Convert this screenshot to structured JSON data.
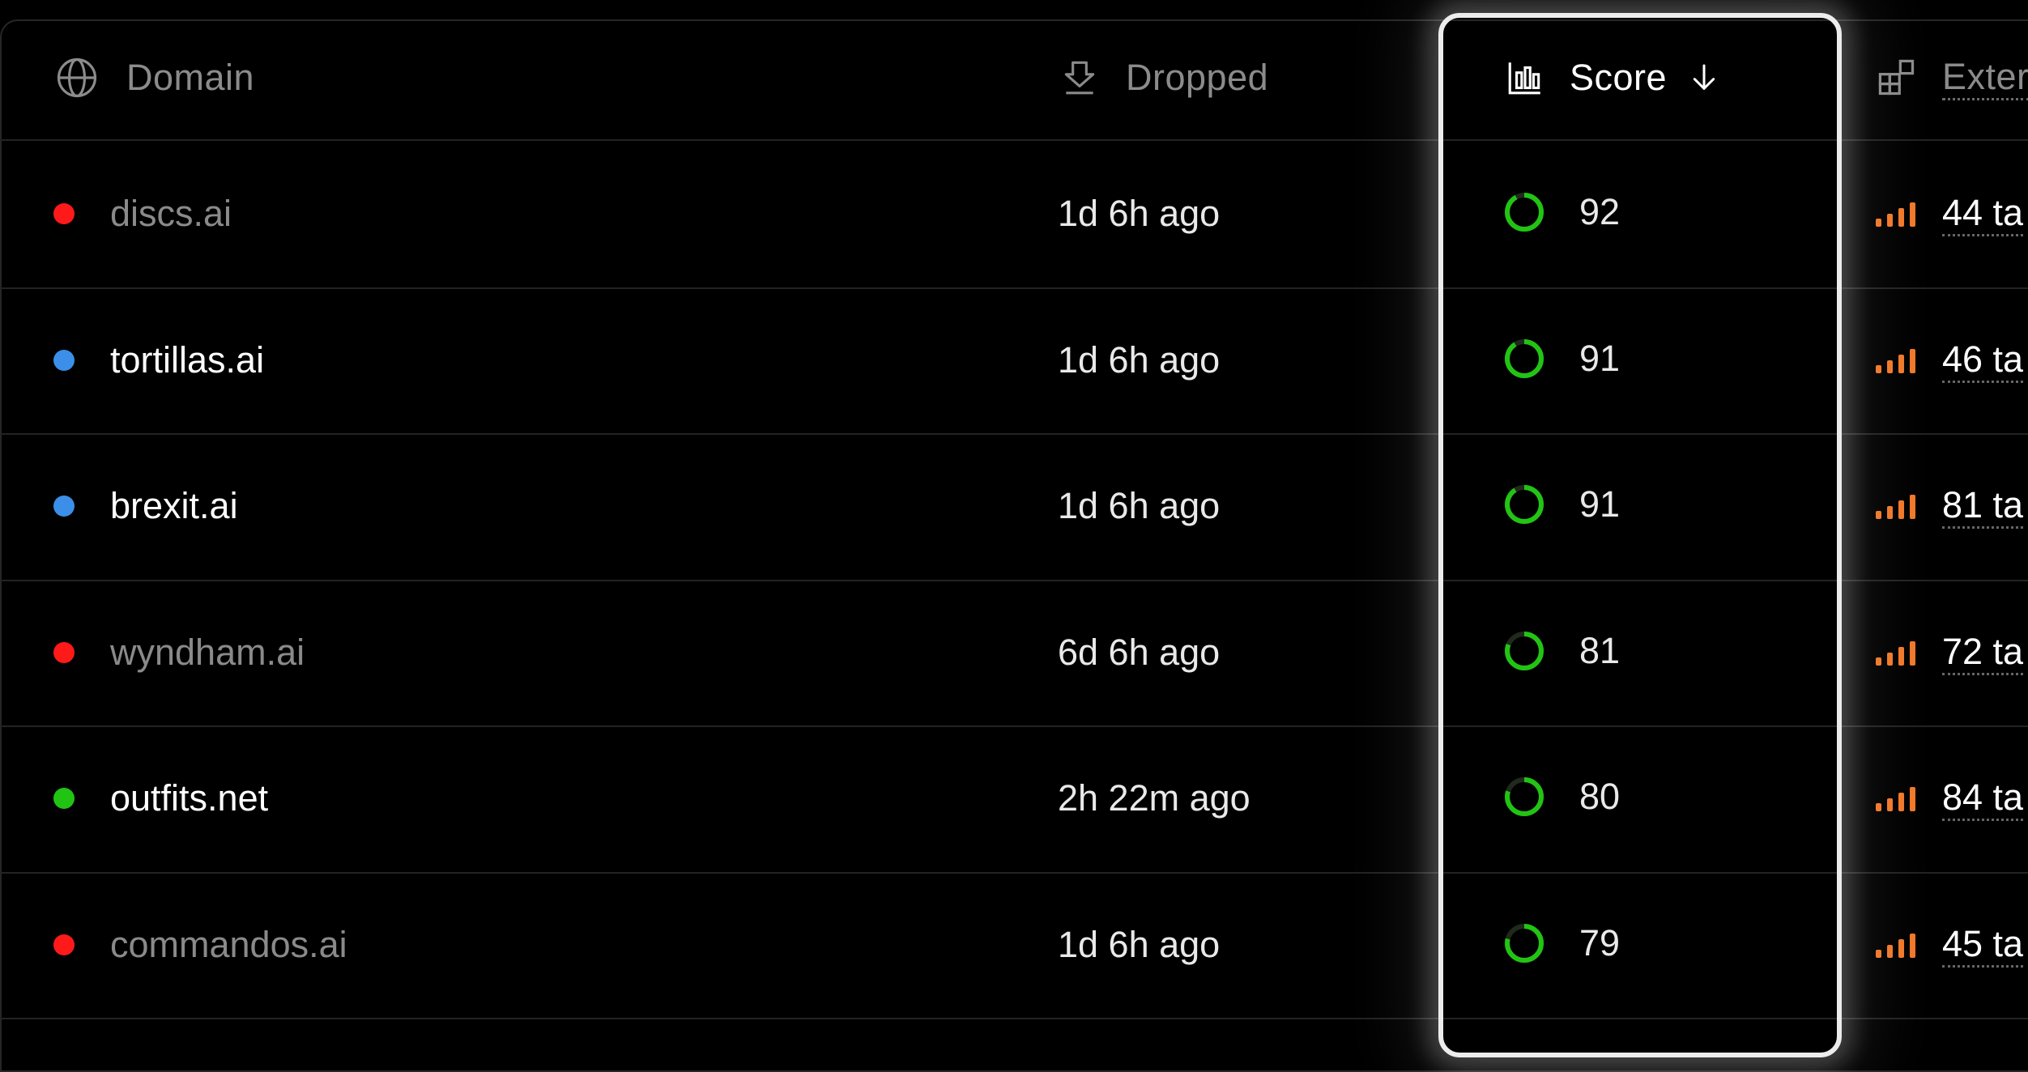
{
  "columns": {
    "domain": "Domain",
    "dropped": "Dropped",
    "score": "Score",
    "external": "Exter"
  },
  "colors": {
    "background": "#000000",
    "status_red": "#ff1a1a",
    "status_blue": "#3b8fe8",
    "status_green": "#22c414",
    "score_ring": "#22c414",
    "bars_orange": "#f0782a"
  },
  "icons": {
    "domain_header": "globe-icon",
    "dropped_header": "drop-arrow-icon",
    "score_header": "bar-chart-icon",
    "score_sort": "arrow-down-icon",
    "external_header": "grid-blocks-icon",
    "row_score": "progress-ring-icon",
    "row_external": "signal-bars-icon"
  },
  "rows": [
    {
      "domain": "discs.ai",
      "status": "red",
      "dropped": "1d 6h ago",
      "score": "92",
      "score_fraction": 0.92,
      "external": "44 ta"
    },
    {
      "domain": "tortillas.ai",
      "status": "blue",
      "dropped": "1d 6h ago",
      "score": "91",
      "score_fraction": 0.91,
      "external": "46 ta"
    },
    {
      "domain": "brexit.ai",
      "status": "blue",
      "dropped": "1d 6h ago",
      "score": "91",
      "score_fraction": 0.91,
      "external": "81 ta"
    },
    {
      "domain": "wyndham.ai",
      "status": "red",
      "dropped": "6d 6h ago",
      "score": "81",
      "score_fraction": 0.81,
      "external": "72 ta"
    },
    {
      "domain": "outfits.net",
      "status": "green",
      "dropped": "2h 22m ago",
      "score": "80",
      "score_fraction": 0.8,
      "external": "84 ta"
    },
    {
      "domain": "commandos.ai",
      "status": "red",
      "dropped": "1d 6h ago",
      "score": "79",
      "score_fraction": 0.79,
      "external": "45 ta"
    }
  ]
}
